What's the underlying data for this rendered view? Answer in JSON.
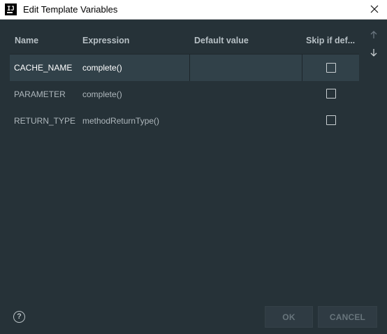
{
  "window": {
    "title": "Edit Template Variables",
    "app_icon_text": "IJ"
  },
  "table": {
    "headers": {
      "name": "Name",
      "expression": "Expression",
      "default_value": "Default value",
      "skip": "Skip if def..."
    },
    "rows": [
      {
        "name": "CACHE_NAME",
        "expression": "complete()",
        "default_value": "",
        "skip": false,
        "selected": true
      },
      {
        "name": "PARAMETER",
        "expression": "complete()",
        "default_value": "",
        "skip": false,
        "selected": false
      },
      {
        "name": "RETURN_TYPE",
        "expression": "methodReturnType()",
        "default_value": "",
        "skip": false,
        "selected": false
      }
    ]
  },
  "controls": {
    "move_up_icon": "arrow-up-icon",
    "move_down_icon": "arrow-down-icon",
    "help_icon": "question-circle-icon"
  },
  "footer": {
    "ok_label": "OK",
    "cancel_label": "CANCEL"
  },
  "colors": {
    "background": "#263238",
    "selected_row": "#314149",
    "button_bg": "#2f3b43"
  }
}
